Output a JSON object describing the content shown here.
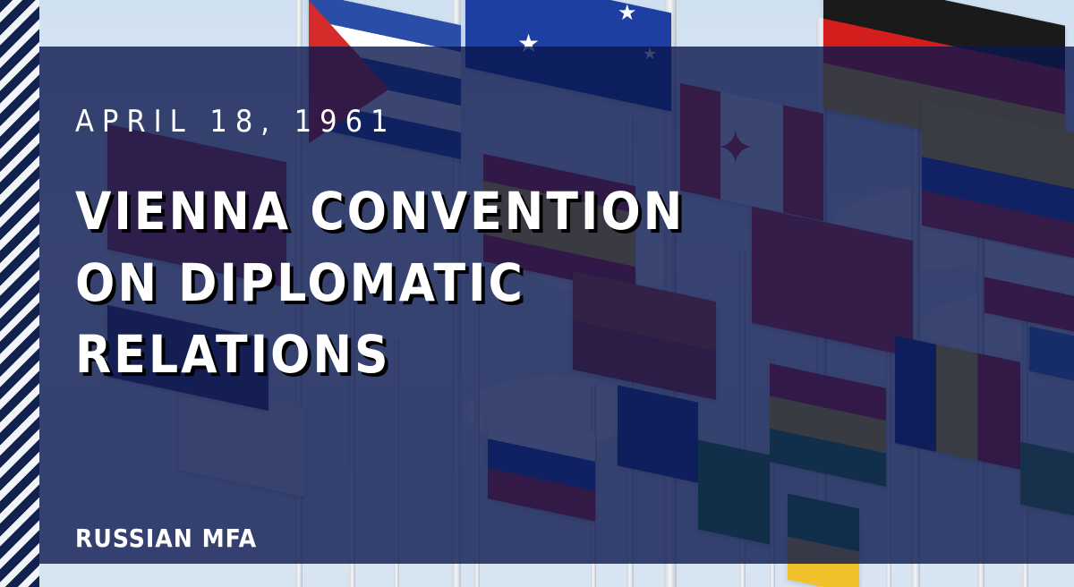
{
  "post": {
    "date": "APRIL 18, 1961",
    "title_lines": [
      "VIENNA CONVENTION",
      "ON DIPLOMATIC",
      "RELATIONS"
    ],
    "source": "RUSSIAN MFA"
  },
  "colors": {
    "overlay": "#0a164e",
    "stripe_dark": "#12224f",
    "stripe_light": "#f2f4f8",
    "text": "#ffffff",
    "title_shadow": "#000000"
  }
}
